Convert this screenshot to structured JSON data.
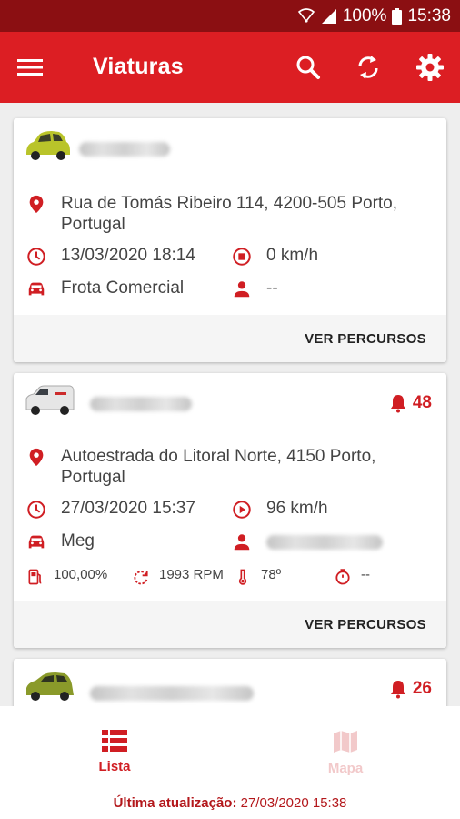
{
  "status_bar": {
    "battery": "100%",
    "time": "15:38"
  },
  "app_bar": {
    "title": "Viaturas",
    "menu_icon": "menu-icon",
    "actions": [
      "search-icon",
      "refresh-icon",
      "settings-icon"
    ]
  },
  "vehicles": [
    {
      "address": [
        "Rua de Tomás Ribeiro 114, 4200-505 Porto,",
        "Portugal"
      ],
      "datetime": "13/03/2020 18:14",
      "speed": "0 km/h",
      "group": "Frota Comercial",
      "driver": "--",
      "action": "VER PERCURSOS",
      "car_color": "#b9c42a"
    },
    {
      "alarms": "48",
      "address": [
        "Autoestrada do Litoral Norte, 4150 Porto,",
        "Portugal"
      ],
      "datetime": "27/03/2020 15:37",
      "speed": "96 km/h",
      "group": "Meg",
      "fuel": "100,00%",
      "rpm": "1993 RPM",
      "temp": "78º",
      "timer": "--",
      "action": "VER PERCURSOS",
      "car_color": "#e8e8e8"
    },
    {
      "alarms": "26",
      "car_color": "#8a9a2a"
    }
  ],
  "bottom_nav": {
    "tabs": [
      {
        "label": "Lista",
        "active": true
      },
      {
        "label": "Mapa",
        "active": false
      }
    ],
    "last_update_label": "Última atualização:",
    "last_update_value": "27/03/2020 15:38"
  },
  "colors": {
    "primary": "#dc1e23",
    "status_bar": "#8b0f12",
    "inactive": "#f2c9ca"
  }
}
